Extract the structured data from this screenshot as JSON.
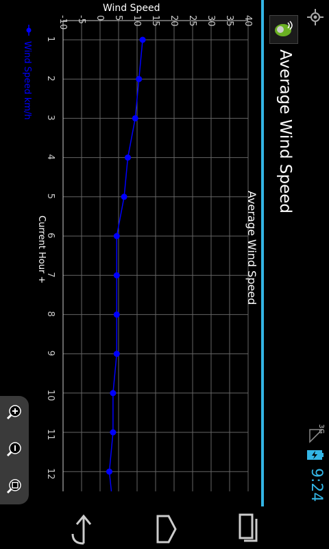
{
  "status_bar": {
    "time": "9:24",
    "network": "3G",
    "icons": [
      "location-icon",
      "signal-icon",
      "battery-charging-icon"
    ]
  },
  "action_bar": {
    "title": "Average Wind Speed",
    "app_icon": "app-logo-icon"
  },
  "zoom_controls": {
    "icons": [
      "zoom-in-icon",
      "zoom-out-icon",
      "zoom-reset-icon"
    ]
  },
  "nav_bar": {
    "icons": [
      "back-icon",
      "home-icon",
      "recent-apps-icon"
    ]
  },
  "colors": {
    "accent": "#33b5e5",
    "series": "#0000ff",
    "grid": "#666666"
  },
  "chart_data": {
    "type": "line",
    "title": "Average Wind Speed",
    "xlabel": "Current Hour +",
    "ylabel": "Wind Speed",
    "x": [
      1,
      2,
      3,
      4,
      5,
      6,
      7,
      8,
      9,
      10,
      11,
      12
    ],
    "x_ticks": [
      "1",
      "2",
      "3",
      "4",
      "5",
      "6",
      "7",
      "8",
      "9",
      "10",
      "11",
      "12"
    ],
    "y_ticks": [
      "-10",
      "-5",
      "0",
      "5",
      "10",
      "15",
      "20",
      "25",
      "30",
      "35",
      "40"
    ],
    "ylim": [
      -10,
      40
    ],
    "series": [
      {
        "name": "Wind Speed  km/h",
        "values": [
          11.5,
          10.5,
          9.5,
          7.5,
          6.5,
          4.5,
          4.5,
          4.5,
          4.5,
          3.5,
          3.5,
          2.5
        ]
      }
    ],
    "grid": true,
    "legend_position": "bottom"
  }
}
